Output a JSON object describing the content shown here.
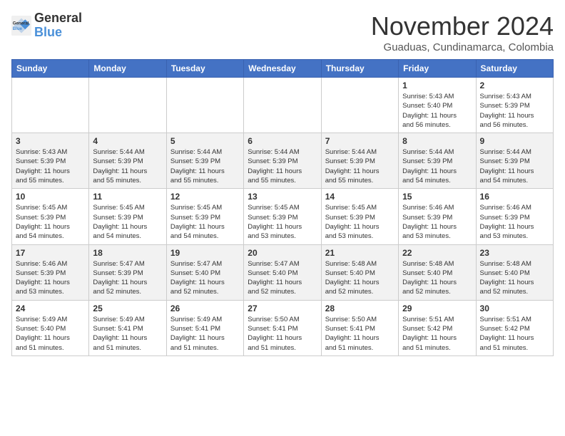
{
  "header": {
    "logo_line1": "General",
    "logo_line2": "Blue",
    "month": "November 2024",
    "location": "Guaduas, Cundinamarca, Colombia"
  },
  "days_of_week": [
    "Sunday",
    "Monday",
    "Tuesday",
    "Wednesday",
    "Thursday",
    "Friday",
    "Saturday"
  ],
  "weeks": [
    [
      {
        "day": "",
        "info": ""
      },
      {
        "day": "",
        "info": ""
      },
      {
        "day": "",
        "info": ""
      },
      {
        "day": "",
        "info": ""
      },
      {
        "day": "",
        "info": ""
      },
      {
        "day": "1",
        "info": "Sunrise: 5:43 AM\nSunset: 5:40 PM\nDaylight: 11 hours\nand 56 minutes."
      },
      {
        "day": "2",
        "info": "Sunrise: 5:43 AM\nSunset: 5:39 PM\nDaylight: 11 hours\nand 56 minutes."
      }
    ],
    [
      {
        "day": "3",
        "info": "Sunrise: 5:43 AM\nSunset: 5:39 PM\nDaylight: 11 hours\nand 55 minutes."
      },
      {
        "day": "4",
        "info": "Sunrise: 5:44 AM\nSunset: 5:39 PM\nDaylight: 11 hours\nand 55 minutes."
      },
      {
        "day": "5",
        "info": "Sunrise: 5:44 AM\nSunset: 5:39 PM\nDaylight: 11 hours\nand 55 minutes."
      },
      {
        "day": "6",
        "info": "Sunrise: 5:44 AM\nSunset: 5:39 PM\nDaylight: 11 hours\nand 55 minutes."
      },
      {
        "day": "7",
        "info": "Sunrise: 5:44 AM\nSunset: 5:39 PM\nDaylight: 11 hours\nand 55 minutes."
      },
      {
        "day": "8",
        "info": "Sunrise: 5:44 AM\nSunset: 5:39 PM\nDaylight: 11 hours\nand 54 minutes."
      },
      {
        "day": "9",
        "info": "Sunrise: 5:44 AM\nSunset: 5:39 PM\nDaylight: 11 hours\nand 54 minutes."
      }
    ],
    [
      {
        "day": "10",
        "info": "Sunrise: 5:45 AM\nSunset: 5:39 PM\nDaylight: 11 hours\nand 54 minutes."
      },
      {
        "day": "11",
        "info": "Sunrise: 5:45 AM\nSunset: 5:39 PM\nDaylight: 11 hours\nand 54 minutes."
      },
      {
        "day": "12",
        "info": "Sunrise: 5:45 AM\nSunset: 5:39 PM\nDaylight: 11 hours\nand 54 minutes."
      },
      {
        "day": "13",
        "info": "Sunrise: 5:45 AM\nSunset: 5:39 PM\nDaylight: 11 hours\nand 53 minutes."
      },
      {
        "day": "14",
        "info": "Sunrise: 5:45 AM\nSunset: 5:39 PM\nDaylight: 11 hours\nand 53 minutes."
      },
      {
        "day": "15",
        "info": "Sunrise: 5:46 AM\nSunset: 5:39 PM\nDaylight: 11 hours\nand 53 minutes."
      },
      {
        "day": "16",
        "info": "Sunrise: 5:46 AM\nSunset: 5:39 PM\nDaylight: 11 hours\nand 53 minutes."
      }
    ],
    [
      {
        "day": "17",
        "info": "Sunrise: 5:46 AM\nSunset: 5:39 PM\nDaylight: 11 hours\nand 53 minutes."
      },
      {
        "day": "18",
        "info": "Sunrise: 5:47 AM\nSunset: 5:39 PM\nDaylight: 11 hours\nand 52 minutes."
      },
      {
        "day": "19",
        "info": "Sunrise: 5:47 AM\nSunset: 5:40 PM\nDaylight: 11 hours\nand 52 minutes."
      },
      {
        "day": "20",
        "info": "Sunrise: 5:47 AM\nSunset: 5:40 PM\nDaylight: 11 hours\nand 52 minutes."
      },
      {
        "day": "21",
        "info": "Sunrise: 5:48 AM\nSunset: 5:40 PM\nDaylight: 11 hours\nand 52 minutes."
      },
      {
        "day": "22",
        "info": "Sunrise: 5:48 AM\nSunset: 5:40 PM\nDaylight: 11 hours\nand 52 minutes."
      },
      {
        "day": "23",
        "info": "Sunrise: 5:48 AM\nSunset: 5:40 PM\nDaylight: 11 hours\nand 52 minutes."
      }
    ],
    [
      {
        "day": "24",
        "info": "Sunrise: 5:49 AM\nSunset: 5:40 PM\nDaylight: 11 hours\nand 51 minutes."
      },
      {
        "day": "25",
        "info": "Sunrise: 5:49 AM\nSunset: 5:41 PM\nDaylight: 11 hours\nand 51 minutes."
      },
      {
        "day": "26",
        "info": "Sunrise: 5:49 AM\nSunset: 5:41 PM\nDaylight: 11 hours\nand 51 minutes."
      },
      {
        "day": "27",
        "info": "Sunrise: 5:50 AM\nSunset: 5:41 PM\nDaylight: 11 hours\nand 51 minutes."
      },
      {
        "day": "28",
        "info": "Sunrise: 5:50 AM\nSunset: 5:41 PM\nDaylight: 11 hours\nand 51 minutes."
      },
      {
        "day": "29",
        "info": "Sunrise: 5:51 AM\nSunset: 5:42 PM\nDaylight: 11 hours\nand 51 minutes."
      },
      {
        "day": "30",
        "info": "Sunrise: 5:51 AM\nSunset: 5:42 PM\nDaylight: 11 hours\nand 51 minutes."
      }
    ]
  ]
}
